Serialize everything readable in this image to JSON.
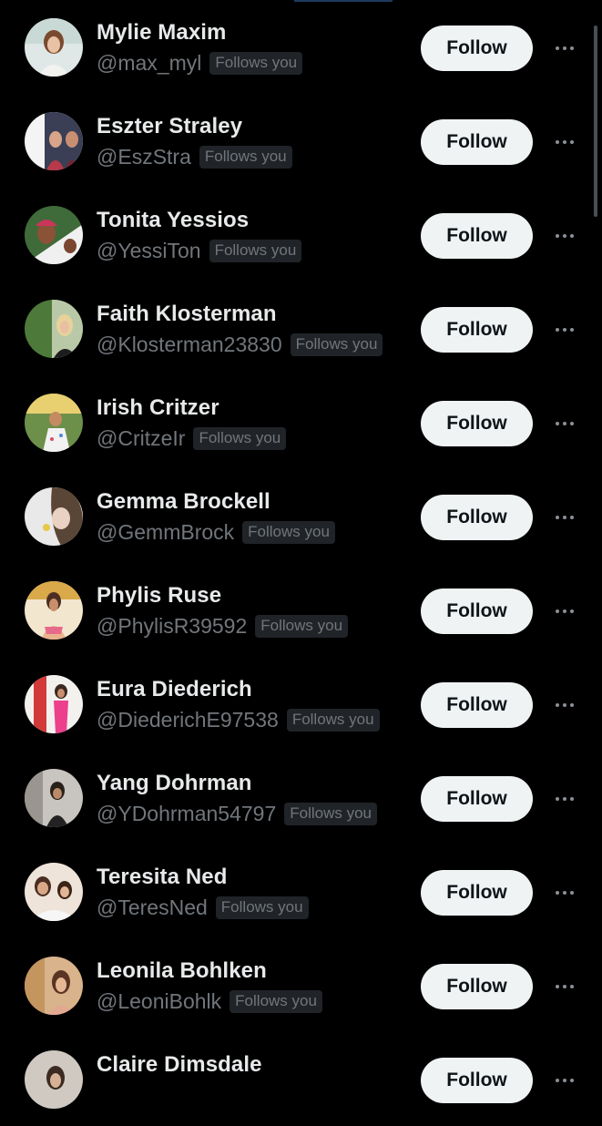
{
  "follow_label": "Follow",
  "follows_you_label": "Follows you",
  "users": [
    {
      "name": "Mylie Maxim",
      "handle": "@max_myl"
    },
    {
      "name": "Eszter Straley",
      "handle": "@EszStra"
    },
    {
      "name": "Tonita Yessios",
      "handle": "@YessiTon"
    },
    {
      "name": "Faith Klosterman",
      "handle": "@Klosterman23830"
    },
    {
      "name": "Irish Critzer",
      "handle": "@CritzeIr"
    },
    {
      "name": "Gemma Brockell",
      "handle": "@GemmBrock"
    },
    {
      "name": "Phylis Ruse",
      "handle": "@PhylisR39592"
    },
    {
      "name": "Eura Diederich",
      "handle": "@DiederichE97538"
    },
    {
      "name": "Yang Dohrman",
      "handle": "@YDohrman54797"
    },
    {
      "name": "Teresita Ned",
      "handle": "@TeresNed"
    },
    {
      "name": "Leonila Bohlken",
      "handle": "@LeoniBohlk"
    },
    {
      "name": "Claire Dimsdale",
      "handle": ""
    }
  ],
  "colors": {
    "background": "#000000",
    "name_text": "#e7e9ea",
    "secondary_text": "#71767b",
    "badge_bg": "#202327",
    "button_bg": "#eff3f4",
    "button_text": "#0f1419"
  }
}
